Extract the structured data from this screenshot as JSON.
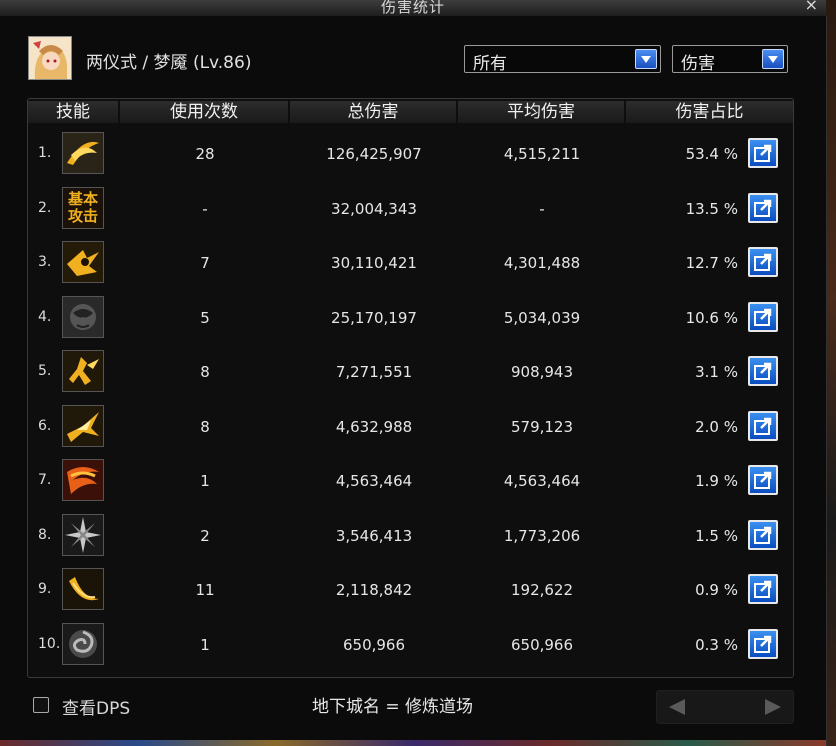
{
  "window": {
    "title": "伤害统计",
    "close_icon": "×"
  },
  "character": {
    "name": "两仪式 / 梦魇 (Lv.86)"
  },
  "filters": {
    "scope": "所有",
    "metric": "伤害"
  },
  "table": {
    "headers": [
      "技能",
      "使用次数",
      "总伤害",
      "平均伤害",
      "伤害占比"
    ],
    "rows": [
      {
        "index": "1.",
        "icon": "golden-slash-icon",
        "uses": "28",
        "total": "126,425,907",
        "average": "4,515,211",
        "percent": "53.4 %"
      },
      {
        "index": "2.",
        "icon": "basic-attack-icon",
        "icon_text": "基本攻击",
        "uses": "-",
        "total": "32,004,343",
        "average": "-",
        "percent": "13.5 %"
      },
      {
        "index": "3.",
        "icon": "golden-dash-icon",
        "uses": "7",
        "total": "30,110,421",
        "average": "4,301,488",
        "percent": "12.7 %"
      },
      {
        "index": "4.",
        "icon": "dark-face-icon",
        "uses": "5",
        "total": "25,170,197",
        "average": "5,034,039",
        "percent": "10.6 %"
      },
      {
        "index": "5.",
        "icon": "golden-figure-icon",
        "uses": "8",
        "total": "7,271,551",
        "average": "908,943",
        "percent": "3.1 %"
      },
      {
        "index": "6.",
        "icon": "golden-burst-icon",
        "uses": "8",
        "total": "4,632,988",
        "average": "579,123",
        "percent": "2.0 %"
      },
      {
        "index": "7.",
        "icon": "flame-slash-icon",
        "uses": "1",
        "total": "4,563,464",
        "average": "4,563,464",
        "percent": "1.9 %"
      },
      {
        "index": "8.",
        "icon": "silver-star-icon",
        "uses": "2",
        "total": "3,546,413",
        "average": "1,773,206",
        "percent": "1.5 %"
      },
      {
        "index": "9.",
        "icon": "crescent-slash-icon",
        "uses": "11",
        "total": "2,118,842",
        "average": "192,622",
        "percent": "0.9 %"
      },
      {
        "index": "10.",
        "icon": "grey-swirl-icon",
        "uses": "1",
        "total": "650,966",
        "average": "650,966",
        "percent": "0.3 %"
      }
    ]
  },
  "footer": {
    "dps_label": "查看DPS",
    "dungeon_text": "地下城名 = 修炼道场"
  },
  "colors": {
    "accent_blue": "#2a6fe0",
    "gold": "#e8b020"
  }
}
